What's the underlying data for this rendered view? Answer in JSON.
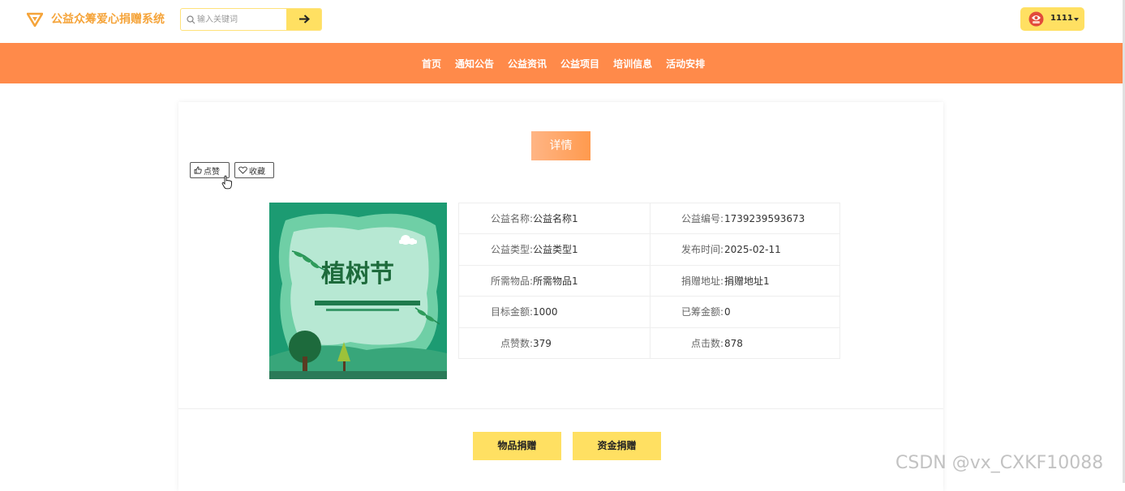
{
  "header": {
    "brand": "公益众筹爱心捐赠系统",
    "search": {
      "placeholder": "输入关键词",
      "value": ""
    },
    "user": {
      "name": "1111"
    }
  },
  "nav": {
    "items": [
      {
        "label": "首页"
      },
      {
        "label": "通知公告"
      },
      {
        "label": "公益资讯"
      },
      {
        "label": "公益项目"
      },
      {
        "label": "培训信息"
      },
      {
        "label": "活动安排"
      }
    ]
  },
  "detail": {
    "tag": "详情",
    "like_label": "点赞",
    "favorite_label": "收藏",
    "poster_title": "植树节",
    "fields": [
      {
        "label": "公益名称:",
        "value": "公益名称1"
      },
      {
        "label": "公益编号:",
        "value": "1739239593673"
      },
      {
        "label": "公益类型:",
        "value": "公益类型1"
      },
      {
        "label": "发布时间:",
        "value": "2025-02-11"
      },
      {
        "label": "所需物品:",
        "value": "所需物品1"
      },
      {
        "label": "捐赠地址:",
        "value": "捐赠地址1"
      },
      {
        "label": "目标金额:",
        "value": "1000"
      },
      {
        "label": "已筹金额:",
        "value": "0"
      },
      {
        "label": "点赞数:",
        "value": "379"
      },
      {
        "label": "点击数:",
        "value": "878"
      }
    ],
    "actions": {
      "goods": "物品捐赠",
      "fund": "资金捐赠"
    }
  },
  "watermark": "CSDN @vx_CXKF10088",
  "colors": {
    "accent": "#ffe062",
    "nav": "#ff8a4a",
    "brand": "#f5a43a"
  }
}
